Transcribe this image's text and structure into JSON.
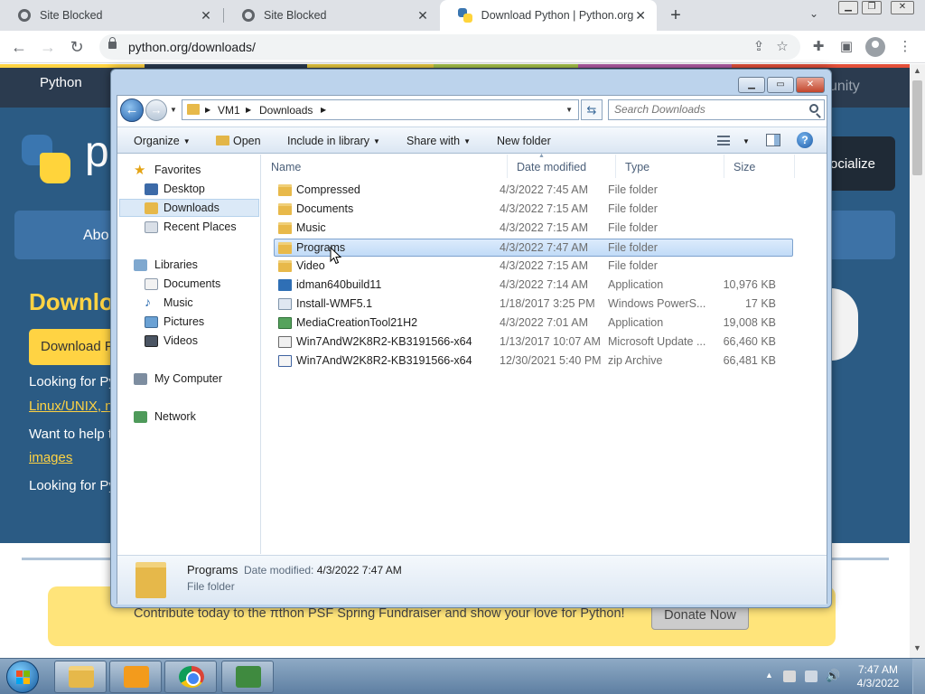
{
  "browser": {
    "tabs": [
      {
        "title": "Site Blocked",
        "active": false
      },
      {
        "title": "Site Blocked",
        "active": false
      },
      {
        "title": "Download Python | Python.org",
        "active": true
      }
    ],
    "url": "python.org/downloads/"
  },
  "page": {
    "nav_python": "Python",
    "nav_community": "unity",
    "logo_text": "p",
    "socialize": "ocialize",
    "menu_about": "Abo",
    "heading": "Downlo",
    "download_button": "Download P",
    "line1": "Looking for Py",
    "link_linux": "Linux/UNIX",
    "link_comma": ", n",
    "line3": "Want to help t",
    "link_images": "images",
    "line5": "Looking for Py",
    "banner_text": "Contribute today to the πthon PSF Spring Fundraiser and show your love for Python!",
    "donate_button": "Donate Now"
  },
  "explorer": {
    "breadcrumb": [
      "VM1",
      "Downloads"
    ],
    "search_placeholder": "Search Downloads",
    "commands": {
      "organize": "Organize",
      "open": "Open",
      "include_in_library": "Include in library",
      "share_with": "Share with",
      "new_folder": "New folder"
    },
    "nav": {
      "favorites": "Favorites",
      "desktop": "Desktop",
      "downloads": "Downloads",
      "recent_places": "Recent Places",
      "libraries": "Libraries",
      "documents": "Documents",
      "music": "Music",
      "pictures": "Pictures",
      "videos": "Videos",
      "my_computer": "My Computer",
      "network": "Network"
    },
    "columns": {
      "name": "Name",
      "date": "Date modified",
      "type": "Type",
      "size": "Size"
    },
    "files": [
      {
        "name": "Compressed",
        "date": "4/3/2022 7:45 AM",
        "type": "File folder",
        "size": "",
        "icon": "folder-icon"
      },
      {
        "name": "Documents",
        "date": "4/3/2022 7:15 AM",
        "type": "File folder",
        "size": "",
        "icon": "folder-icon"
      },
      {
        "name": "Music",
        "date": "4/3/2022 7:15 AM",
        "type": "File folder",
        "size": "",
        "icon": "folder-icon"
      },
      {
        "name": "Programs",
        "date": "4/3/2022 7:47 AM",
        "type": "File folder",
        "size": "",
        "icon": "folder-icon",
        "selected": true
      },
      {
        "name": "Video",
        "date": "4/3/2022 7:15 AM",
        "type": "File folder",
        "size": "",
        "icon": "folder-icon"
      },
      {
        "name": "idman640build11",
        "date": "4/3/2022 7:14 AM",
        "type": "Application",
        "size": "10,976 KB",
        "icon": "application-icon"
      },
      {
        "name": "Install-WMF5.1",
        "date": "1/18/2017 3:25 PM",
        "type": "Windows PowerS...",
        "size": "17 KB",
        "icon": "powershell-script-icon"
      },
      {
        "name": "MediaCreationTool21H2",
        "date": "4/3/2022 7:01 AM",
        "type": "Application",
        "size": "19,008 KB",
        "icon": "installer-icon"
      },
      {
        "name": "Win7AndW2K8R2-KB3191566-x64",
        "date": "1/13/2017 10:07 AM",
        "type": "Microsoft Update ...",
        "size": "66,460 KB",
        "icon": "update-package-icon"
      },
      {
        "name": "Win7AndW2K8R2-KB3191566-x64",
        "date": "12/30/2021 5:40 PM",
        "type": "zip Archive",
        "size": "66,481 KB",
        "icon": "zip-archive-icon"
      }
    ],
    "details": {
      "name": "Programs",
      "modified_label": "Date modified:",
      "modified_value": "4/3/2022 7:47 AM",
      "type": "File folder"
    }
  },
  "taskbar": {
    "time": "7:47 AM",
    "date": "4/3/2022"
  },
  "colors": {
    "python_header": "#2b5b84",
    "python_yellow": "#ffd343",
    "selection": "#c1dbf7"
  }
}
